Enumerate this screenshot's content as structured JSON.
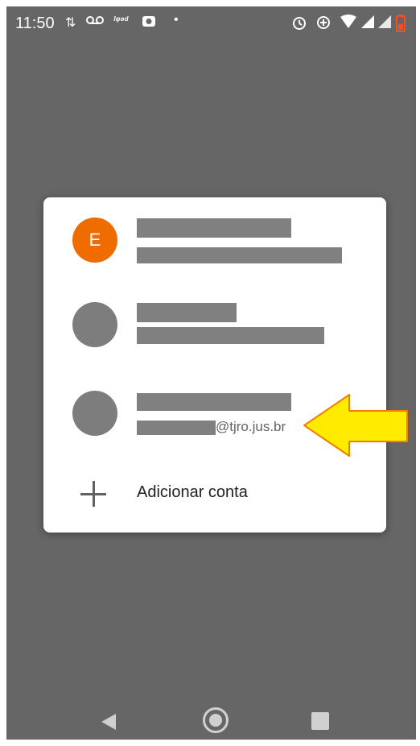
{
  "status_bar": {
    "time": "11:50",
    "left_icons": [
      "data-transfer-icon",
      "voicemail-icon",
      "carrier-icon",
      "camera-notification-icon",
      "dot-icon"
    ],
    "right_icons": [
      "alarm-icon",
      "data-saver-icon",
      "wifi-icon",
      "signal-icon",
      "signal-icon",
      "battery-low-icon"
    ],
    "battery_color": "#f4511e"
  },
  "account_dialog": {
    "accounts": [
      {
        "avatar_letter": "E",
        "avatar_color": "#ef6c00",
        "name": "",
        "email": ""
      },
      {
        "avatar_letter": "",
        "avatar_color": "#7d7d7d",
        "name": "",
        "email": ""
      },
      {
        "avatar_letter": "",
        "avatar_color": "#7d7d7d",
        "name": "",
        "email": "@tjro.jus.br"
      }
    ],
    "add_account_label": "Adicionar conta"
  },
  "annotation": {
    "arrow_color": "#ffeb00",
    "arrow_outline": "#f57c00"
  },
  "nav_bar": {
    "icons": [
      "back-icon",
      "home-icon",
      "recents-icon"
    ]
  }
}
